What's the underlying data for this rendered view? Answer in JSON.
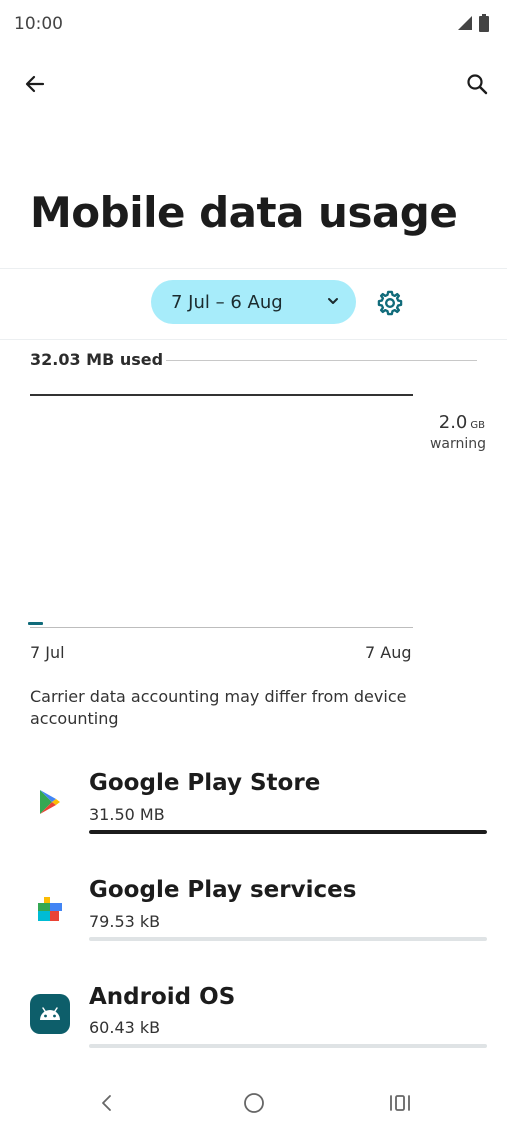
{
  "status_bar": {
    "time": "10:00",
    "icons": [
      "signal-icon",
      "battery-icon"
    ]
  },
  "app_bar": {
    "back_icon": "arrow-back-icon",
    "search_icon": "search-icon"
  },
  "page": {
    "title": "Mobile data usage"
  },
  "cycle": {
    "label": "7 Jul – 6 Aug",
    "settings_icon": "gear-icon"
  },
  "usage": {
    "used_text": "32.03 MB used"
  },
  "chart": {
    "warning_value": "2.0",
    "warning_unit": "GB",
    "warning_label": "warning",
    "start_label": "7 Jul",
    "end_label": "7 Aug"
  },
  "note": "Carrier data accounting may differ from device accounting",
  "apps": [
    {
      "name": "Google Play Store",
      "size": "31.50 MB",
      "share": 1.0,
      "icon": "play-store-icon"
    },
    {
      "name": "Google Play services",
      "size": "79.53 kB",
      "share": 0.0,
      "icon": "play-services-icon"
    },
    {
      "name": "Android OS",
      "size": "60.43 kB",
      "share": 0.0,
      "icon": "android-icon"
    }
  ],
  "colors": {
    "accent": "#106b7a",
    "chip_bg": "#a7ecfa",
    "text": "#1c1c1c"
  }
}
